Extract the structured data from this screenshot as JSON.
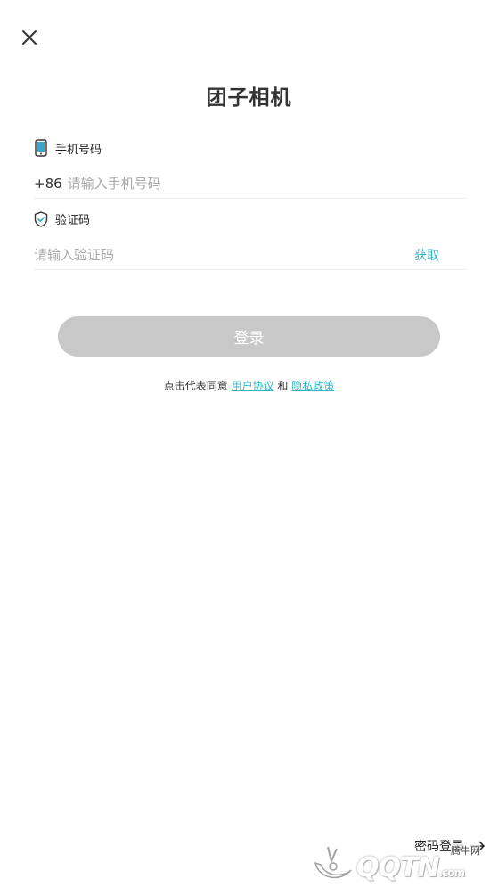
{
  "header": {
    "title": "团子相机"
  },
  "phone": {
    "label": "手机号码",
    "prefix": "+86",
    "placeholder": "请输入手机号码",
    "value": ""
  },
  "code": {
    "label": "验证码",
    "placeholder": "请输入验证码",
    "value": "",
    "get_label": "获取"
  },
  "login": {
    "label": "登录"
  },
  "agreement": {
    "prefix": "点击代表同意",
    "user_agreement": "用户协议",
    "and": "和",
    "privacy": "隐私政策"
  },
  "footer": {
    "password_login": "密码登录"
  },
  "watermark": {
    "text": "QQTN",
    "suffix": ".com",
    "cn": "腾牛网"
  },
  "colors": {
    "accent": "#35b6c4",
    "button_disabled": "#c8c8c8",
    "phone_icon": "#3aa7c9"
  }
}
